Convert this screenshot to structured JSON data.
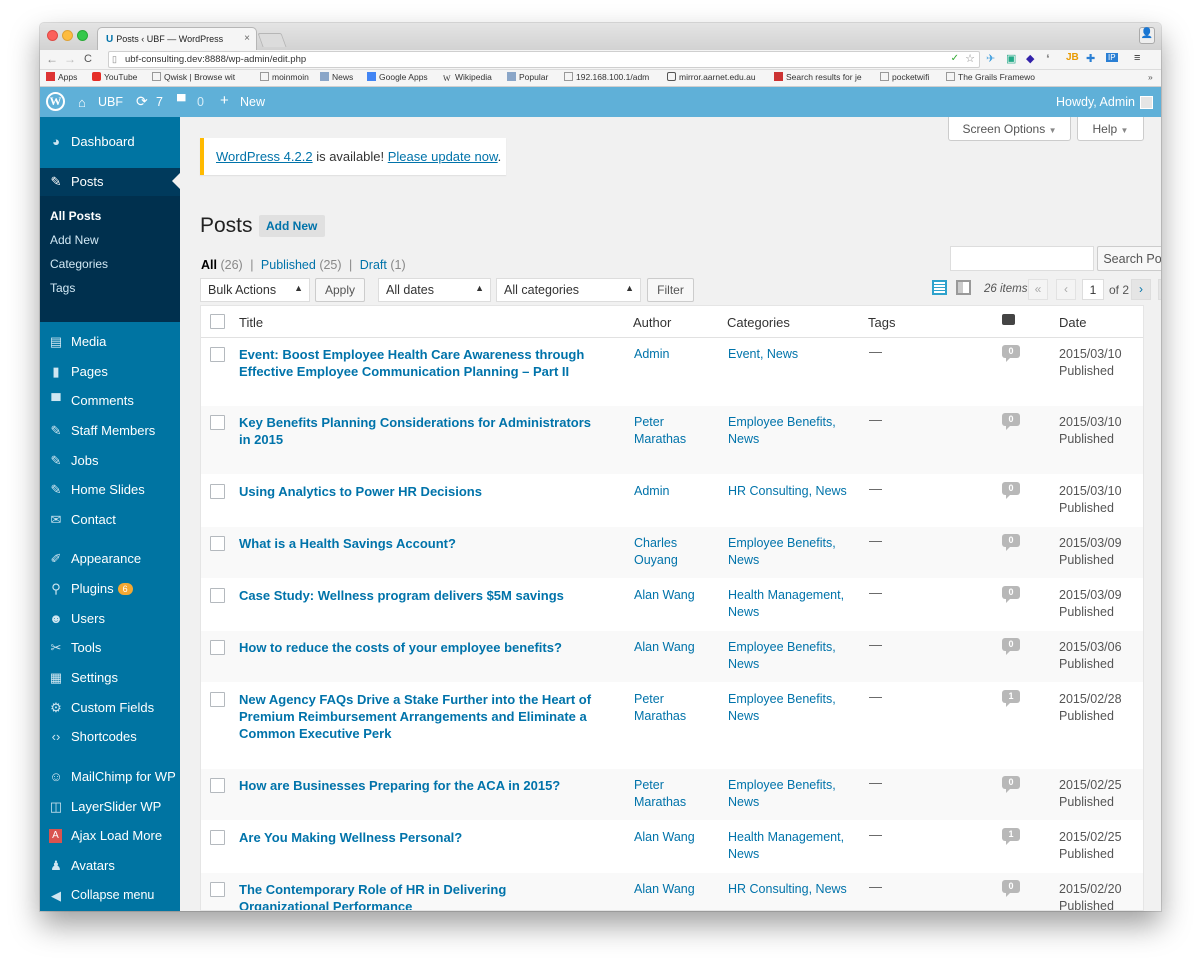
{
  "browser": {
    "tab_title": "Posts ‹ UBF — WordPress",
    "tab_close": "×",
    "url": "ubf-consulting.dev:8888/wp-admin/edit.php",
    "bookmarks": [
      "Apps",
      "YouTube",
      "Qwisk | Browse wit",
      "moinmoin",
      "News",
      "Google Apps",
      "Wikipedia",
      "Popular",
      "192.168.100.1/adm",
      "mirror.aarnet.edu.au",
      "Search results for je",
      "pocketwifi",
      "The Grails Framewo"
    ]
  },
  "adminbar": {
    "site": "UBF",
    "updates": "7",
    "comments": "0",
    "new": "New",
    "greeting": "Howdy, Admin"
  },
  "sidebar": {
    "items": [
      {
        "label": "Dashboard",
        "icon": "dashboard-icon"
      },
      {
        "label": "Posts",
        "icon": "pin-icon"
      },
      {
        "label": "Media",
        "icon": "media-icon"
      },
      {
        "label": "Pages",
        "icon": "pages-icon"
      },
      {
        "label": "Comments",
        "icon": "comments-icon"
      },
      {
        "label": "Staff Members",
        "icon": "pin-icon"
      },
      {
        "label": "Jobs",
        "icon": "pin-icon"
      },
      {
        "label": "Home Slides",
        "icon": "pin-icon"
      },
      {
        "label": "Contact",
        "icon": "mail-icon"
      },
      {
        "label": "Appearance",
        "icon": "brush-icon"
      },
      {
        "label": "Plugins",
        "icon": "plugin-icon",
        "badge": "6"
      },
      {
        "label": "Users",
        "icon": "users-icon"
      },
      {
        "label": "Tools",
        "icon": "wrench-icon"
      },
      {
        "label": "Settings",
        "icon": "settings-icon"
      },
      {
        "label": "Custom Fields",
        "icon": "gear-icon"
      },
      {
        "label": "Shortcodes",
        "icon": "code-icon"
      },
      {
        "label": "MailChimp for WP",
        "icon": "mailchimp-icon"
      },
      {
        "label": "LayerSlider WP",
        "icon": "layers-icon"
      },
      {
        "label": "Ajax Load More",
        "icon": "ajax-icon"
      },
      {
        "label": "Avatars",
        "icon": "avatar-icon"
      },
      {
        "label": "Collapse menu",
        "icon": "collapse-icon"
      }
    ],
    "submenu": [
      "All Posts",
      "Add New",
      "Categories",
      "Tags"
    ]
  },
  "header": {
    "screen_options": "Screen Options",
    "help": "Help"
  },
  "notice": {
    "version_link": "WordPress 4.2.2",
    "text": " is available! ",
    "update_link": "Please update now",
    "end": "."
  },
  "page": {
    "title": "Posts",
    "add_new": "Add New"
  },
  "filters": {
    "all": "All",
    "all_count": "(26)",
    "published": "Published",
    "published_count": "(25)",
    "draft": "Draft",
    "draft_count": "(1)",
    "bulk_actions": "Bulk Actions",
    "apply": "Apply",
    "dates": "All dates",
    "categories": "All categories",
    "filter": "Filter",
    "search_button": "Search Posts",
    "items": "26 items",
    "page": "1",
    "of_pages": "of 2"
  },
  "table": {
    "headers": {
      "title": "Title",
      "author": "Author",
      "categories": "Categories",
      "tags": "Tags",
      "date": "Date"
    },
    "rows": [
      {
        "title": "Event: Boost Employee Health Care Awareness through Effective Employee Communication Planning – Part II",
        "author": "Admin",
        "categories": "Event, News",
        "tags": "—",
        "comments": "0",
        "date": "2015/03/10",
        "status": "Published"
      },
      {
        "title": "Key Benefits Planning Considerations for Administrators in 2015",
        "author": "Peter Marathas",
        "categories": "Employee Benefits, News",
        "tags": "—",
        "comments": "0",
        "date": "2015/03/10",
        "status": "Published"
      },
      {
        "title": "Using Analytics to Power HR Decisions",
        "author": "Admin",
        "categories": "HR Consulting, News",
        "tags": "—",
        "comments": "0",
        "date": "2015/03/10",
        "status": "Published"
      },
      {
        "title": "What is a Health Savings Account?",
        "author": "Charles Ouyang",
        "categories": "Employee Benefits, News",
        "tags": "—",
        "comments": "0",
        "date": "2015/03/09",
        "status": "Published"
      },
      {
        "title": "Case Study: Wellness program delivers $5M savings",
        "author": "Alan Wang",
        "categories": "Health Management, News",
        "tags": "—",
        "comments": "0",
        "date": "2015/03/09",
        "status": "Published"
      },
      {
        "title": "How to reduce the costs of your employee benefits?",
        "author": "Alan Wang",
        "categories": "Employee Benefits, News",
        "tags": "—",
        "comments": "0",
        "date": "2015/03/06",
        "status": "Published"
      },
      {
        "title": "New Agency FAQs Drive a Stake Further into the Heart of Premium Reimbursement Arrangements and Eliminate a Common Executive Perk",
        "author": "Peter Marathas",
        "categories": "Employee Benefits, News",
        "tags": "—",
        "comments": "1",
        "date": "2015/02/28",
        "status": "Published"
      },
      {
        "title": "How are Businesses Preparing for the ACA in 2015?",
        "author": "Peter Marathas",
        "categories": "Employee Benefits, News",
        "tags": "—",
        "comments": "0",
        "date": "2015/02/25",
        "status": "Published"
      },
      {
        "title": "Are You Making Wellness Personal?",
        "author": "Alan Wang",
        "categories": "Health Management, News",
        "tags": "—",
        "comments": "1",
        "date": "2015/02/25",
        "status": "Published"
      },
      {
        "title": "The Contemporary Role of HR in Delivering Organizational Performance",
        "author": "Alan Wang",
        "categories": "HR Consulting, News",
        "tags": "—",
        "comments": "0",
        "date": "2015/02/20",
        "status": "Published"
      }
    ]
  },
  "colors": {
    "sidebar": "#0074a2",
    "sidebar_current": "#003a5c",
    "adminbar": "#5fb0d8",
    "link": "#0073aa",
    "notice_border": "#ffba00"
  }
}
